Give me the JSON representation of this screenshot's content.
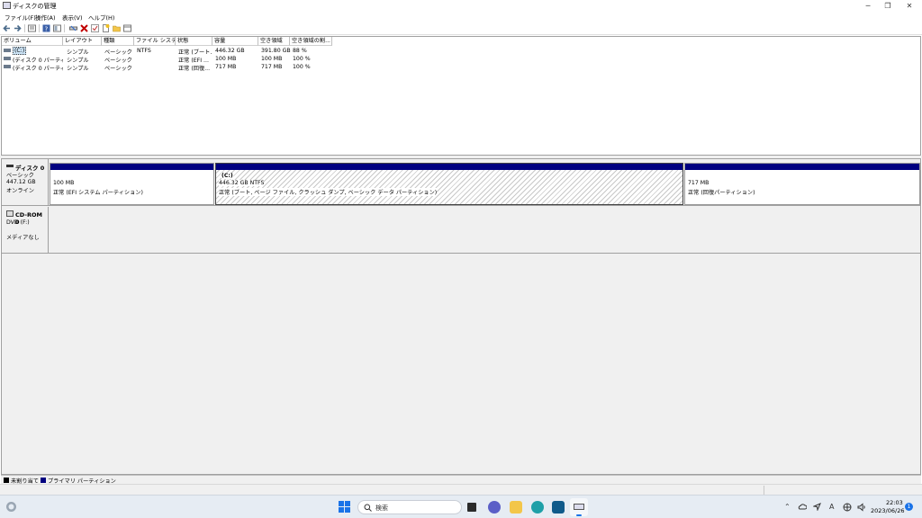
{
  "window": {
    "title": "ディスクの管理",
    "minimize_icon": "minimize-icon",
    "maximize_icon": "maximize-icon",
    "close_icon": "close-icon"
  },
  "menu": [
    "ファイル(F)",
    "操作(A)",
    "表示(V)",
    "ヘルプ(H)"
  ],
  "toolbar": {
    "icons": [
      "back-arrow-icon",
      "forward-arrow-icon",
      "properties-list-icon",
      "help-icon",
      "console-icon",
      "rescan-icon",
      "delete-icon",
      "check-icon",
      "new-icon",
      "folder-icon",
      "view-icon"
    ]
  },
  "volume_list": {
    "columns": [
      "ボリューム",
      "レイアウト",
      "種類",
      "ファイル システム",
      "状態",
      "容量",
      "空き領域",
      "空き領域の割..."
    ],
    "rows": [
      [
        "(C:)",
        "シンプル",
        "ベーシック",
        "NTFS",
        "正常 (ブート...",
        "446.32 GB",
        "391.80 GB",
        "88 %"
      ],
      [
        "(ディスク 0 パーティシ...",
        "シンプル",
        "ベーシック",
        "",
        "正常 (EFI ...",
        "100 MB",
        "100 MB",
        "100 %"
      ],
      [
        "(ディスク 0 パーティシ...",
        "シンプル",
        "ベーシック",
        "",
        "正常 (回復...",
        "717 MB",
        "717 MB",
        "100 %"
      ]
    ]
  },
  "disk0": {
    "name": "ディスク 0",
    "type": "ベーシック",
    "size": "447.12 GB",
    "status": "オンライン",
    "partitions": [
      {
        "name": "",
        "size": "100 MB",
        "status": "正常 (EFI システム パーティション)"
      },
      {
        "name": "(C:)",
        "size": "446.32 GB NTFS",
        "status": "正常 (ブート, ページ ファイル, クラッシュ ダンプ, ベーシック データ パーティション)"
      },
      {
        "name": "",
        "size": "717 MB",
        "status": "正常 (回復パーティション)"
      }
    ]
  },
  "cdrom0": {
    "name": "CD-ROM 0",
    "type": "DVD (F:)",
    "status": "メディアなし"
  },
  "legend": {
    "unallocated": "未割り当て",
    "primary": "プライマリ パーティション",
    "unallocated_color": "#000000",
    "primary_color": "#000080"
  },
  "taskbar": {
    "search_label": "検索",
    "time": "22:03",
    "date": "2023/06/26",
    "notification_count": "1",
    "ime": "A"
  }
}
